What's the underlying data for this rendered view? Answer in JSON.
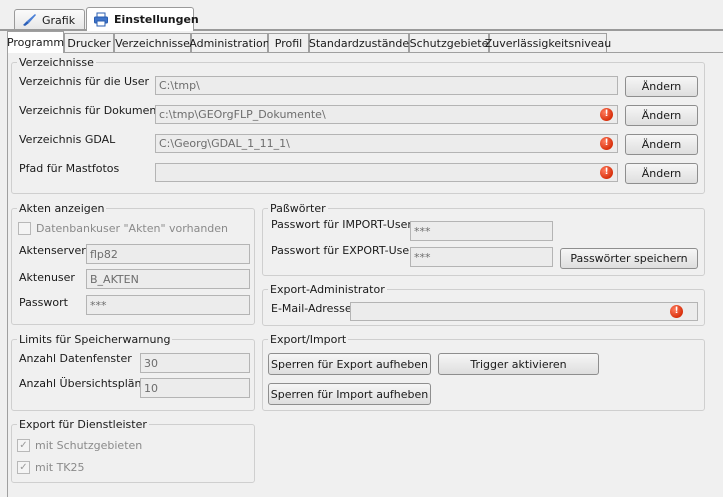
{
  "top_tabs": [
    {
      "label": "Grafik",
      "icon": "brush-icon",
      "active": false
    },
    {
      "label": "Einstellungen",
      "icon": "printer-icon",
      "active": true
    }
  ],
  "sub_tabs": [
    {
      "label": "Programm",
      "active": true
    },
    {
      "label": "Drucker"
    },
    {
      "label": "Verzeichnisse"
    },
    {
      "label": "Administration"
    },
    {
      "label": "Profil"
    },
    {
      "label": "Standardzustände"
    },
    {
      "label": "Schutzgebiete"
    },
    {
      "label": "Zuverlässigkeitsniveau"
    }
  ],
  "verzeichnisse": {
    "title": "Verzeichnisse",
    "rows": [
      {
        "label": "Verzeichnis für die User",
        "value": "C:\\tmp\\",
        "error": false,
        "button": "Ändern"
      },
      {
        "label": "Verzeichnis für Dokumente",
        "value": "c:\\tmp\\GEOrgFLP_Dokumente\\",
        "error": true,
        "button": "Ändern"
      },
      {
        "label": "Verzeichnis GDAL",
        "value": "C:\\Georg\\GDAL_1_11_1\\",
        "error": true,
        "button": "Ändern"
      },
      {
        "label": "Pfad für Mastfotos",
        "value": "",
        "error": true,
        "button": "Ändern"
      }
    ]
  },
  "akten": {
    "title": "Akten anzeigen",
    "checkbox_label": "Datenbankuser \"Akten\" vorhanden",
    "checkbox_checked": false,
    "server_label": "Aktenserver",
    "server_value": "flp82",
    "user_label": "Aktenuser",
    "user_value": "B_AKTEN",
    "password_label": "Passwort",
    "password_value": "***"
  },
  "passwoerter": {
    "title": "Paßwörter",
    "import_label": "Passwort für IMPORT-User",
    "import_value": "***",
    "export_label": "Passwort für EXPORT-User",
    "export_value": "***",
    "save_button": "Passwörter speichern"
  },
  "limits": {
    "title": "Limits für Speicherwarnung",
    "datenfenster_label": "Anzahl Datenfenster",
    "datenfenster_value": "30",
    "uebersicht_label": "Anzahl Übersichtspläne",
    "uebersicht_value": "10"
  },
  "export_admin": {
    "title": "Export-Administrator",
    "email_label": "E-Mail-Adresse",
    "email_value": "",
    "error": true
  },
  "export_import": {
    "title": "Export/Import",
    "unlock_export_button": "Sperren für Export aufheben",
    "trigger_button": "Trigger aktivieren",
    "unlock_import_button": "Sperren für Import aufheben"
  },
  "dienstleister": {
    "title": "Export für Dienstleister",
    "opt1_label": "mit Schutzgebieten",
    "opt1_checked": true,
    "opt2_label": "mit TK25",
    "opt2_checked": true
  }
}
